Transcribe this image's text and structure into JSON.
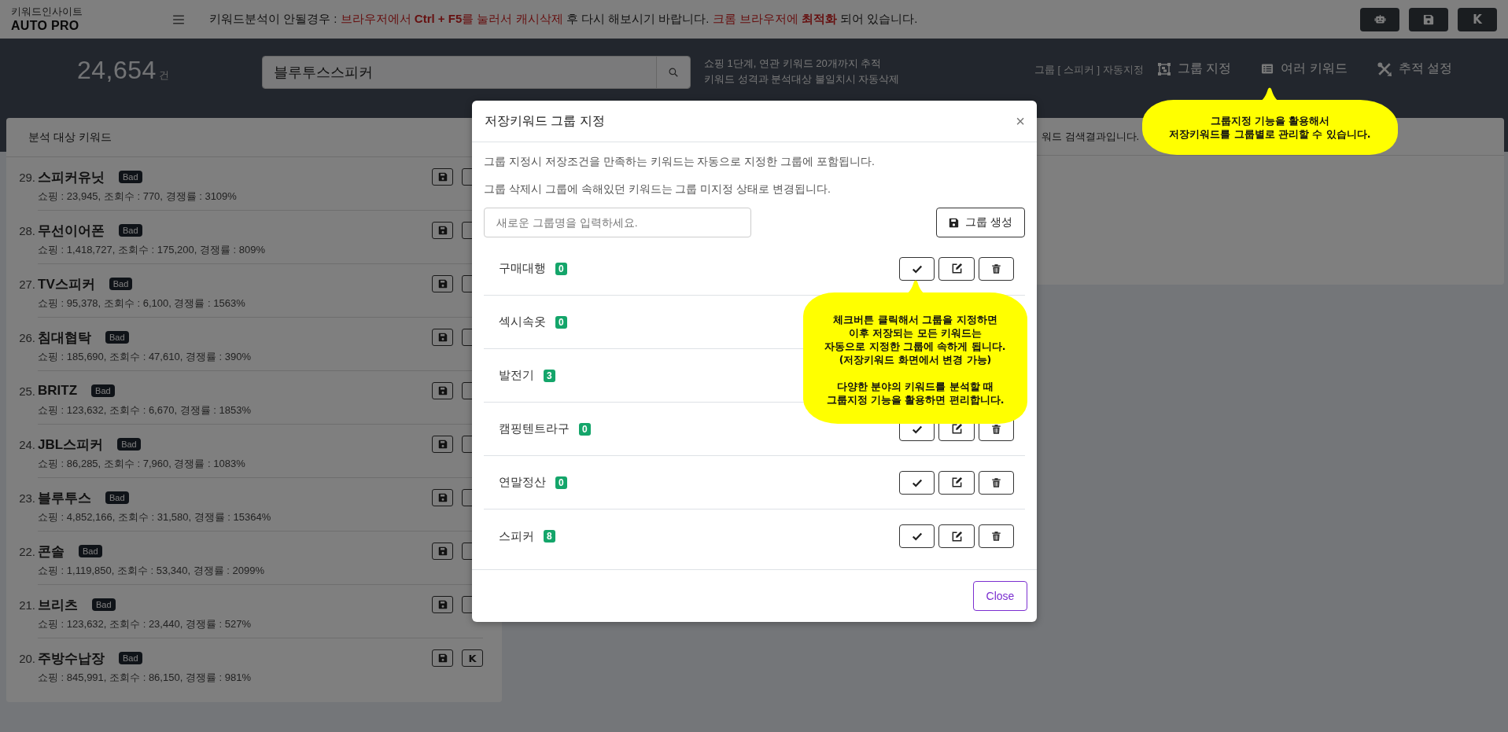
{
  "top_bar": {
    "logo_subtitle": "키워드인사이트",
    "logo_title": "AUTO PRO",
    "notice": [
      {
        "kind": "plain",
        "text": "키워드분석이 안될경우 : "
      },
      {
        "kind": "warn",
        "text": "브라우저에서 **Ctrl + F5**를 눌러서 캐시삭제"
      },
      {
        "kind": "plain",
        "text": " 후 다시 해보시기 바랍니다. "
      },
      {
        "kind": "warn",
        "text": "크롬 브라우저에 **최적화**"
      },
      {
        "kind": "plain",
        "text": " 되어 있습니다."
      }
    ],
    "buttons": [
      {
        "kind": "robot"
      },
      {
        "kind": "save"
      },
      {
        "kind": "letter",
        "label": "K"
      }
    ]
  },
  "header": {
    "count": "24,654",
    "count_unit": "건",
    "search": {
      "value": "블루투스스피커"
    },
    "info": [
      "쇼핑 1단계, 연관 키워드 20개까지 추적",
      "키워드 성격과 분석대상 불일치시 자동삭제"
    ],
    "auto_group": "그룹 [ 스피커 ] 자동지정",
    "links": [
      {
        "kind": "group",
        "label": "그룹 지정"
      },
      {
        "kind": "list",
        "label": "여러 키워드"
      },
      {
        "kind": "tools",
        "label": "추적 설정"
      }
    ]
  },
  "keyword_panel": {
    "title": "분석 대상 키워드",
    "rows": [
      {
        "rank": "29.",
        "keyword": "스피커유닛",
        "badge": "Bad",
        "stats": "쇼핑 : 23,945, 조회수 : 770, 경쟁률 : 3109%"
      },
      {
        "rank": "28.",
        "keyword": "무선이어폰",
        "badge": "Bad",
        "stats": "쇼핑 : 1,418,727, 조회수 : 175,200, 경쟁률 : 809%"
      },
      {
        "rank": "27.",
        "keyword": "TV스피커",
        "badge": "Bad",
        "stats": "쇼핑 : 95,378, 조회수 : 6,100, 경쟁률 : 1563%"
      },
      {
        "rank": "26.",
        "keyword": "침대협탁",
        "badge": "Bad",
        "stats": "쇼핑 : 185,690, 조회수 : 47,610, 경쟁률 : 390%"
      },
      {
        "rank": "25.",
        "keyword": "BRITZ",
        "badge": "Bad",
        "stats": "쇼핑 : 123,632, 조회수 : 6,670, 경쟁률 : 1853%"
      },
      {
        "rank": "24.",
        "keyword": "JBL스피커",
        "badge": "Bad",
        "stats": "쇼핑 : 86,285, 조회수 : 7,960, 경쟁률 : 1083%"
      },
      {
        "rank": "23.",
        "keyword": "블루투스",
        "badge": "Bad",
        "stats": "쇼핑 : 4,852,166, 조회수 : 31,580, 경쟁률 : 15364%"
      },
      {
        "rank": "22.",
        "keyword": "콘솔",
        "badge": "Bad",
        "stats": "쇼핑 : 1,119,850, 조회수 : 53,340, 경쟁률 : 2099%"
      },
      {
        "rank": "21.",
        "keyword": "브리츠",
        "badge": "Bad",
        "stats": "쇼핑 : 123,632, 조회수 : 23,440, 경쟁률 : 527%"
      },
      {
        "rank": "20.",
        "keyword": "주방수납장",
        "badge": "Bad",
        "stats": "쇼핑 : 845,991, 조회수 : 86,150, 경쟁률 : 981%",
        "k_button": "K"
      }
    ]
  },
  "result_panel": {
    "text": "워드 검색결과입니다."
  },
  "modal": {
    "title": "저장키워드 그룹 지정",
    "close_symbol": "×",
    "notes": [
      "그룹 지정시 저장조건을 만족하는 키워드는 자동으로 지정한 그룹에 포함됩니다.",
      "그룹 삭제시 그룹에 속해있던 키워드는 그룹 미지정 상태로 변경됩니다."
    ],
    "new_group": {
      "placeholder": "새로운 그룹명을 입력하세요."
    },
    "create_button": "그룹 생성",
    "groups": [
      {
        "name": "구매대행",
        "count": "0"
      },
      {
        "name": "섹시속옷",
        "count": "0"
      },
      {
        "name": "발전기",
        "count": "3"
      },
      {
        "name": "캠핑텐트라구",
        "count": "0"
      },
      {
        "name": "연말정산",
        "count": "0"
      },
      {
        "name": "스피커",
        "count": "8"
      }
    ],
    "close_button": "Close"
  },
  "callouts": [
    {
      "text": "그룹지정 기능을 활용해서\n저장키워드를 그룹별로 관리할 수 있습니다."
    },
    {
      "text": "체크버튼 클릭해서 그룹을 지정하면\n이후 저장되는 모든 키워드는\n자동으로 지정한 그룹에 속하게 됩니다.\n(저장키워드 화면에서 변경 가능)\n\n다양한 분야의 키워드를 분석할 때\n그룹지정 기능을 활용하면 편리합니다."
    }
  ]
}
